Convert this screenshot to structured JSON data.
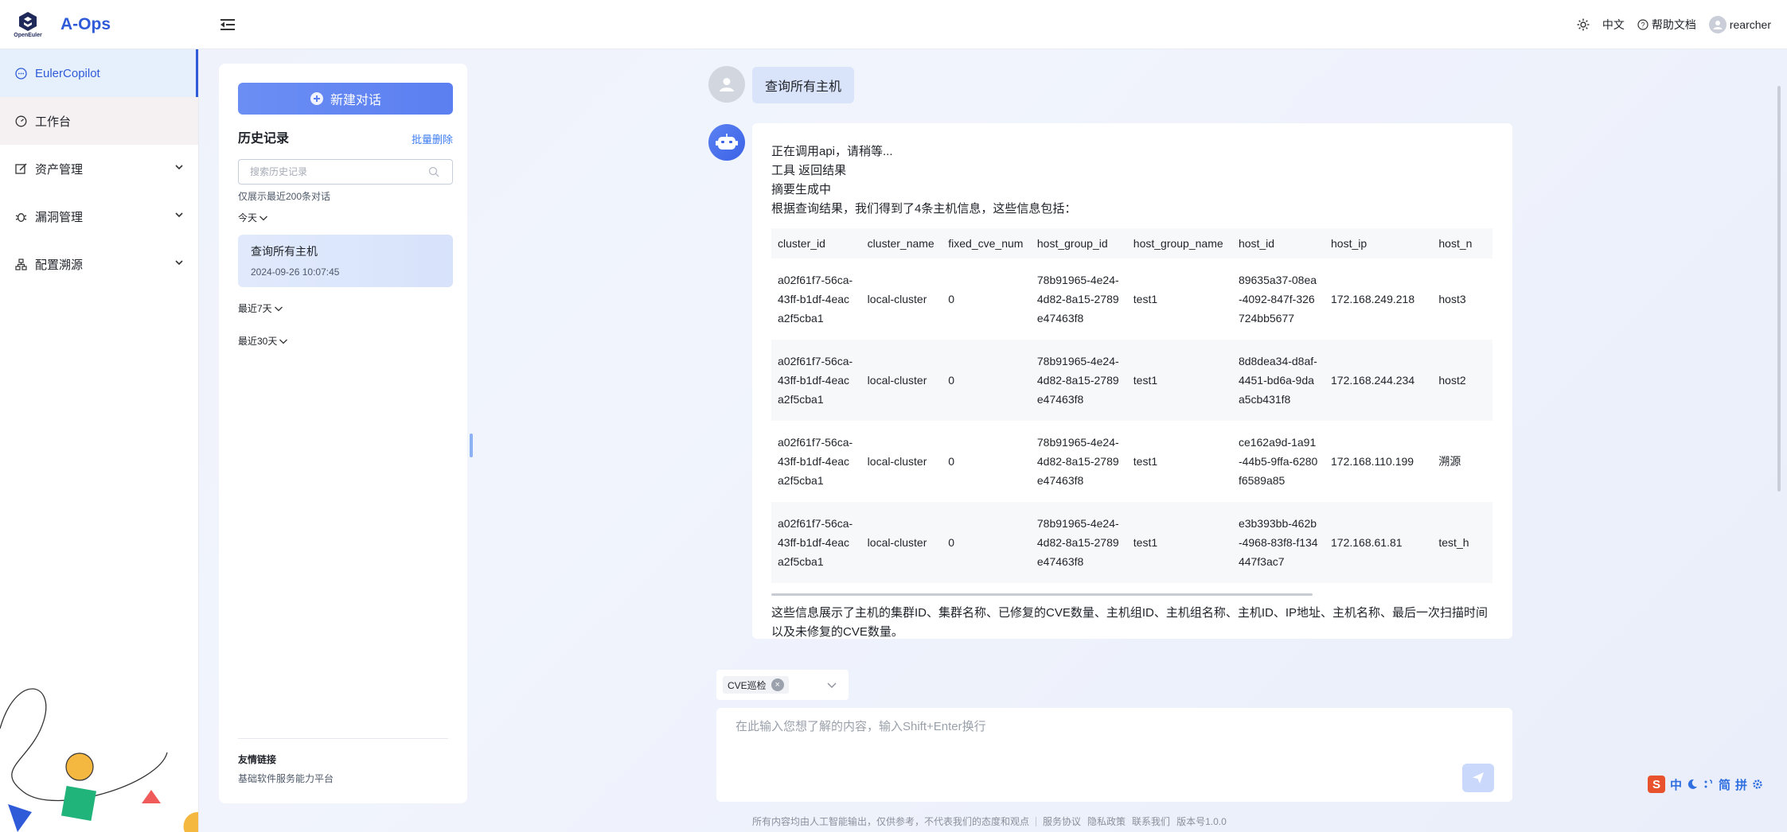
{
  "header": {
    "logo_text": "OpenEuler",
    "app_name": "A-Ops",
    "lang": "中文",
    "help": "帮助文档",
    "user": "rearcher"
  },
  "sidebar": {
    "items": [
      {
        "label": "EulerCopilot"
      },
      {
        "label": "工作台"
      },
      {
        "label": "资产管理"
      },
      {
        "label": "漏洞管理"
      },
      {
        "label": "配置溯源"
      }
    ]
  },
  "history": {
    "new_chat": "新建对话",
    "title": "历史记录",
    "batch_delete": "批量删除",
    "search_placeholder": "搜索历史记录",
    "limit_note": "仅展示最近200条对话",
    "groups": {
      "today": "今天",
      "week": "最近7天",
      "month": "最近30天"
    },
    "items": [
      {
        "title": "查询所有主机",
        "time": "2024-09-26 10:07:45"
      }
    ],
    "friend_title": "友情链接",
    "friend_link": "基础软件服务能力平台"
  },
  "chat": {
    "user_message": "查询所有主机",
    "bot_lines": [
      "正在调用api，请稍等...",
      "工具 返回结果",
      "摘要生成中",
      "根据查询结果，我们得到了4条主机信息，这些信息包括："
    ],
    "table": {
      "headers": [
        "cluster_id",
        "cluster_name",
        "fixed_cve_num",
        "host_group_id",
        "host_group_name",
        "host_id",
        "host_ip",
        "host_n"
      ],
      "rows": [
        [
          "a02f61f7-56ca-43ff-b1df-4eaca2f5cba1",
          "local-cluster",
          "0",
          "78b91965-4e24-4d82-8a15-2789e47463f8",
          "test1",
          "89635a37-08ea-4092-847f-326724bb5677",
          "172.168.249.218",
          "host3"
        ],
        [
          "a02f61f7-56ca-43ff-b1df-4eaca2f5cba1",
          "local-cluster",
          "0",
          "78b91965-4e24-4d82-8a15-2789e47463f8",
          "test1",
          "8d8dea34-d8af-4451-bd6a-9daa5cb431f8",
          "172.168.244.234",
          "host2"
        ],
        [
          "a02f61f7-56ca-43ff-b1df-4eaca2f5cba1",
          "local-cluster",
          "0",
          "78b91965-4e24-4d82-8a15-2789e47463f8",
          "test1",
          "ce162a9d-1a91-44b5-9ffa-6280f6589a85",
          "172.168.110.199",
          "溯源"
        ],
        [
          "a02f61f7-56ca-43ff-b1df-4eaca2f5cba1",
          "local-cluster",
          "0",
          "78b91965-4e24-4d82-8a15-2789e47463f8",
          "test1",
          "e3b393bb-462b-4968-83f8-f134447f3ac7",
          "172.168.61.81",
          "test_h"
        ]
      ]
    },
    "summary": "这些信息展示了主机的集群ID、集群名称、已修复的CVE数量、主机组ID、主机组名称、主机ID、IP地址、主机名称、最后一次扫描时间以及未修复的CVE数量。"
  },
  "composer": {
    "plugin_tag": "CVE巡检",
    "placeholder": "在此输入您想了解的内容，输入Shift+Enter换行"
  },
  "footer": {
    "disclaimer": "所有内容均由人工智能输出，仅供参考，不代表我们的态度和观点",
    "terms": "服务协议",
    "privacy": "隐私政策",
    "contact": "联系我们",
    "version": "版本号1.0.0"
  },
  "ime": {
    "logo": "S",
    "mode": "中",
    "simp": "简",
    "pinyin": "拼"
  },
  "colors": {
    "accent": "#2f5bd8",
    "button_gradient": "#6b8ef4",
    "history_card": "#dde6fb"
  }
}
